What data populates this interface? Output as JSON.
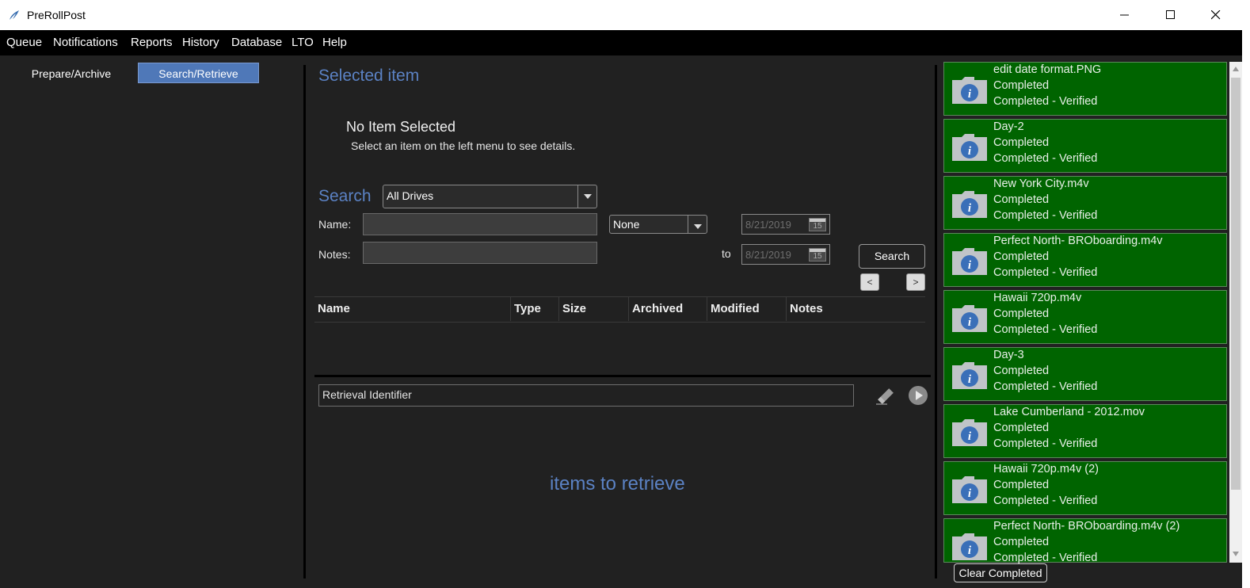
{
  "window": {
    "title": "PreRollPost"
  },
  "menu": [
    "Queue",
    "Notifications",
    "Reports",
    "History",
    "Database",
    "LTO",
    "Help"
  ],
  "tabs": {
    "prepare": "Prepare/Archive",
    "search": "Search/Retrieve",
    "active": "Search/Retrieve"
  },
  "selected": {
    "heading": "Selected item",
    "title": "No Item Selected",
    "hint": "Select an item on the left menu to see details."
  },
  "search": {
    "heading": "Search",
    "drive": "All Drives",
    "name_label": "Name:",
    "notes_label": "Notes:",
    "date_filter": "None",
    "date_from": "8/21/2019",
    "to_label": "to",
    "date_to": "8/21/2019",
    "calendar_day": "15",
    "button": "Search",
    "prev": "<",
    "next": ">"
  },
  "results": {
    "columns": [
      "Name",
      "Type",
      "Size",
      "Archived",
      "Modified",
      "Notes"
    ]
  },
  "retrieve": {
    "placeholder": "Retrieval Identifier",
    "empty_text": "items to retrieve"
  },
  "queue": {
    "items": [
      {
        "name": "edit date format.PNG",
        "status": "Completed",
        "detail": "Completed - Verified"
      },
      {
        "name": "Day-2",
        "status": "Completed",
        "detail": "Completed - Verified"
      },
      {
        "name": "New York City.m4v",
        "status": "Completed",
        "detail": "Completed - Verified"
      },
      {
        "name": "Perfect North- BROboarding.m4v",
        "status": "Completed",
        "detail": "Completed - Verified"
      },
      {
        "name": "Hawaii 720p.m4v",
        "status": "Completed",
        "detail": "Completed - Verified"
      },
      {
        "name": "Day-3",
        "status": "Completed",
        "detail": "Completed - Verified"
      },
      {
        "name": "Lake Cumberland - 2012.mov",
        "status": "Completed",
        "detail": "Completed - Verified"
      },
      {
        "name": "Hawaii 720p.m4v (2)",
        "status": "Completed",
        "detail": "Completed - Verified"
      },
      {
        "name": "Perfect North- BROboarding.m4v (2)",
        "status": "Completed",
        "detail": "Completed - Verified"
      }
    ],
    "clear_button": "Clear Completed"
  },
  "colors": {
    "accent": "#5b82c4",
    "card_green": "#006400",
    "background": "#212121"
  }
}
